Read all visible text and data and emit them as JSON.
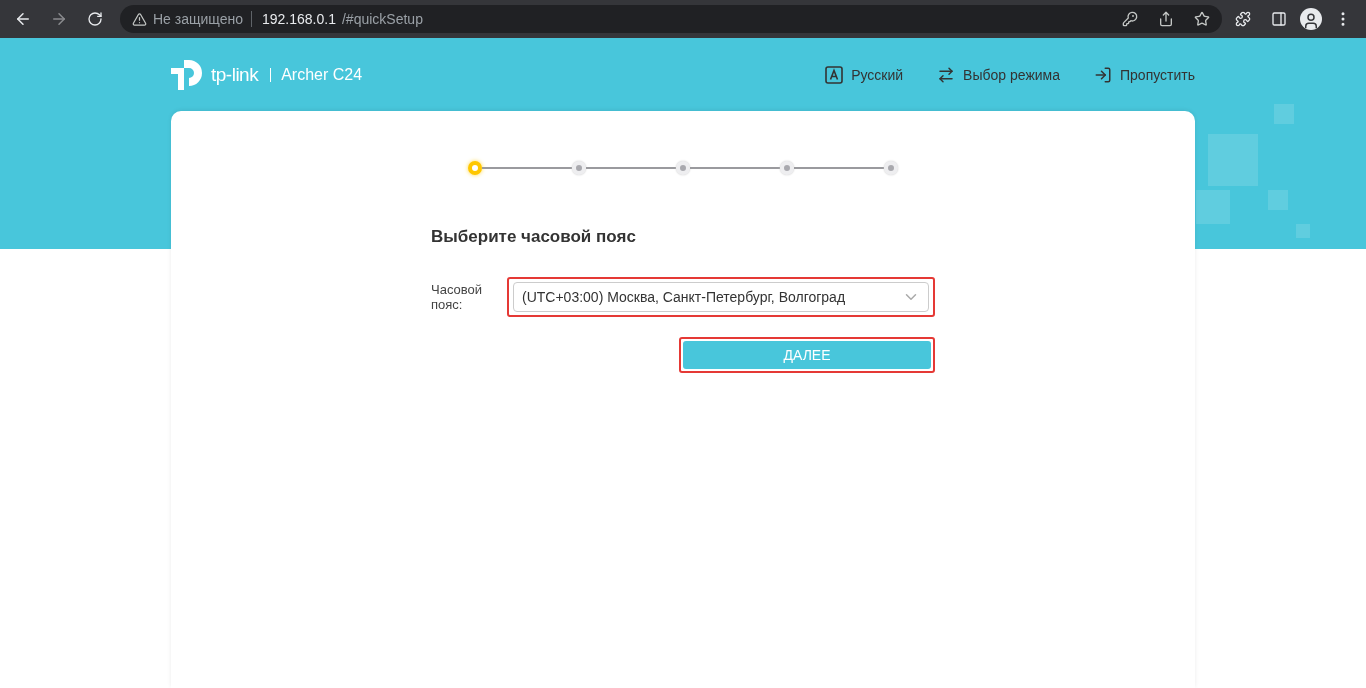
{
  "browser": {
    "security": "Не защищено",
    "url_host": "192.168.0.1",
    "url_path": "/#quickSetup"
  },
  "header": {
    "brand": "tp-link",
    "model": "Archer C24",
    "actions": [
      {
        "kind": "language",
        "label": "Русский"
      },
      {
        "kind": "mode",
        "label": "Выбор режима"
      },
      {
        "kind": "skip",
        "label": "Пропустить"
      }
    ]
  },
  "steps": [
    {
      "selected": true
    },
    {
      "selected": false
    },
    {
      "selected": false
    },
    {
      "selected": false
    },
    {
      "selected": false
    }
  ],
  "form": {
    "title": "Выберите часовой пояс",
    "field_label": "Часовой пояс:",
    "value": "(UTC+03:00) Москва, Санкт-Петербург, Волгоград",
    "highlighted": true
  },
  "next_button": {
    "label": "ДАЛЕЕ",
    "highlighted": true
  }
}
